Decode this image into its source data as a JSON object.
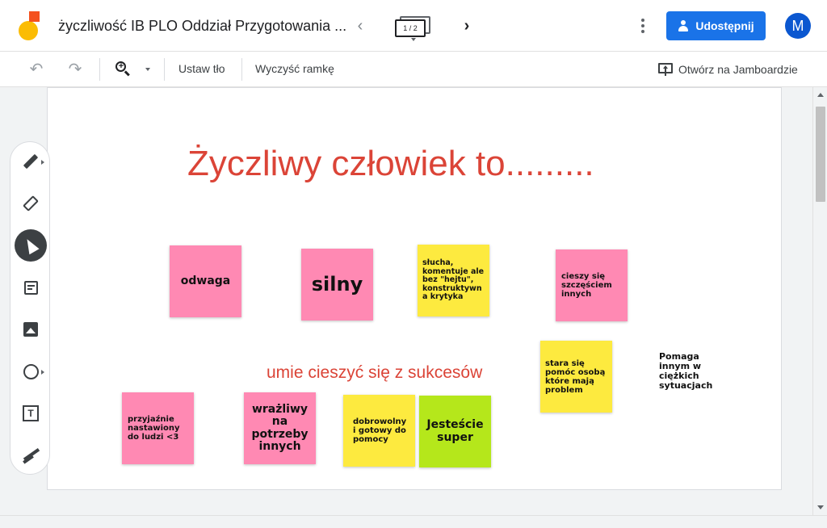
{
  "header": {
    "title": "życzliwość IB PLO Oddział Przygotowania ...",
    "frame_counter": "1 / 2",
    "share_label": "Udostępnij",
    "avatar_initial": "M"
  },
  "toolbar": {
    "set_background": "Ustaw tło",
    "clear_frame": "Wyczyść ramkę",
    "open_in_jamboard": "Otwórz na Jamboardzie"
  },
  "tools": [
    "pen",
    "eraser",
    "select",
    "sticky-note",
    "image",
    "circle",
    "text-box",
    "laser"
  ],
  "board": {
    "title": "Życzliwy człowiek to.........",
    "subtitle": "umie cieszyć się z sukcesów",
    "free_text": "Pomaga innym w ciężkich sytuacjach",
    "notes": [
      {
        "text": "odwaga",
        "color": "#ff89b3"
      },
      {
        "text": "silny",
        "color": "#ff89b3"
      },
      {
        "text": "słucha, komentuje ale bez \"hejtu\", konstruktywna krytyka",
        "color": "#fdea3f"
      },
      {
        "text": "cieszy się szczęściem innych",
        "color": "#ff89b3"
      },
      {
        "text": "stara się pomóc osobą które mają problem",
        "color": "#fdea3f"
      },
      {
        "text": "przyjaźnie nastawiony do ludzi <3",
        "color": "#ff89b3"
      },
      {
        "text": "wrażliwy na potrzeby innych",
        "color": "#ff89b3"
      },
      {
        "text": "dobrowolny i gotowy do pomocy",
        "color": "#fdea3f"
      },
      {
        "text": "Jesteście super",
        "color": "#b5e71b"
      }
    ]
  },
  "colors": {
    "accent": "#1a73e8",
    "title_red": "#db4437"
  }
}
